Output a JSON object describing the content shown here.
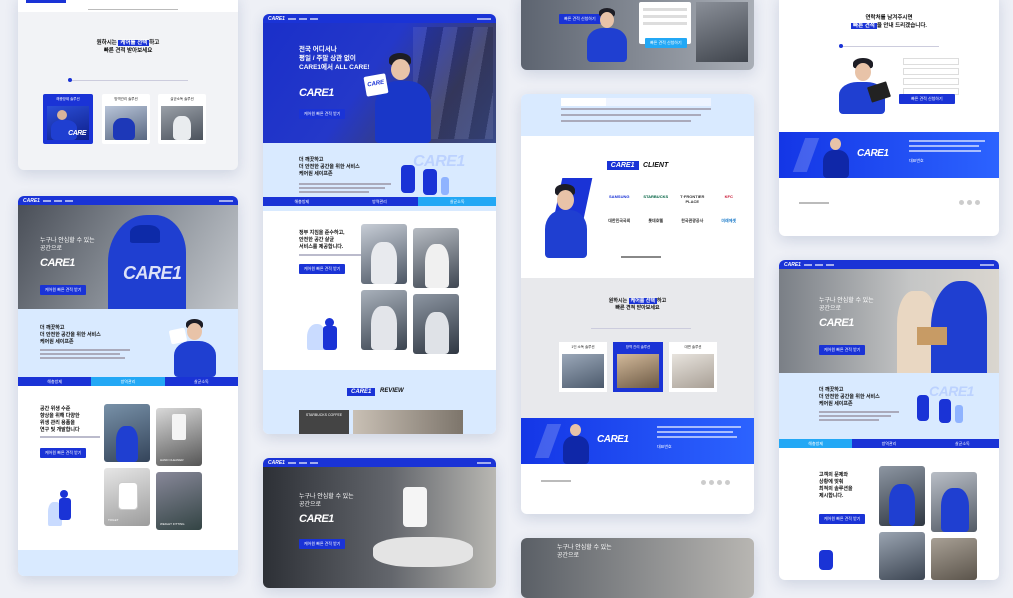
{
  "brand": "CARE",
  "brand_sub": "1",
  "brand_full": "CARE1",
  "client_label": "CLIENT",
  "review_label": "REVIEW",
  "slogan": {
    "line1": "전국 어디서나",
    "line2": "평일 / 주말 상관 없이",
    "line3a": "CARE1",
    "line3b": "에서 ALL CARE!"
  },
  "service_intro": {
    "line1": "더 깨끗하고",
    "line2": "더 안전한 공간을 위한 서비스",
    "line3": "케어원 세이프존"
  },
  "safe_space": {
    "line1": "누구나 안심할 수 있는",
    "line2": "공간으로"
  },
  "choose": {
    "line1a": "원하시는 ",
    "line1b": "케어를 선택",
    "line1c": "하고",
    "line2": "빠른 견적 받아보세요"
  },
  "consult": {
    "line1": "연락처를 남겨주시면",
    "line2a": "빠른 견적",
    "line2b": "을 안내 드리겠습니다."
  },
  "standards": {
    "line1": "정부 지침을 준수하고,",
    "line2": "안전한 공간 살균",
    "line3": "서비스를 제공합니다."
  },
  "hygiene": {
    "line1": "공간 위생 수준",
    "line2": "향상을 위해 다양한",
    "line3": "위생 관리 용품을",
    "line4": "연구 및 개발합니다"
  },
  "customer": {
    "line1": "고객의 문제와",
    "line2": "상황에 맞춰",
    "line3": "최적의 솔루션을",
    "line4": "제시합니다."
  },
  "tabs": [
    "해충방제",
    "방역관리",
    "살균소독"
  ],
  "solutions": [
    "해충방제 솔루션",
    "방역관리 솔루션",
    "살균소독 솔루션"
  ],
  "solutions_b": [
    "1인 소독 솔루션",
    "방역 관리 솔루션",
    "대면 솔루션"
  ],
  "cta_label": "케어원 빠른 견적 받기",
  "quote_cta": "빠른 견적 신청하기",
  "review_logo": "STARBUCKS COFFEE",
  "clients": [
    "SAMSUNG",
    "STARBUCKS",
    "T·FRONTIER PLACE",
    "KFC",
    "대한민국국회",
    "롯데호텔",
    "한국관광공사",
    "미래에셋"
  ],
  "product_labels": [
    "HAND CLEANER",
    "TOILET",
    "WEIGHT FITTING"
  ],
  "phone_label": "대표번호",
  "colors": {
    "primary": "#1a33d6",
    "accent": "#23a8f5",
    "bg": "#eef0f6"
  }
}
